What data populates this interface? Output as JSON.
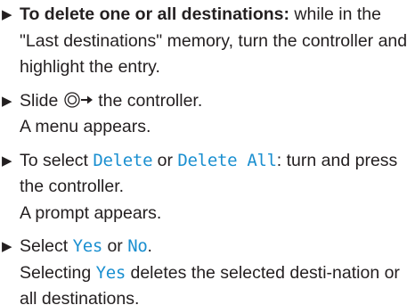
{
  "colors": {
    "text": "#231f20",
    "display_text": "#1a8fd0"
  },
  "steps": [
    {
      "bullet": "▶",
      "bold": "To delete one or all destinations:",
      "text": " while in the \"Last destinations\" memory, turn the controller and highlight the entry."
    },
    {
      "bullet": "▶",
      "pre": "Slide ",
      "icon": "controller-slide-right-icon",
      "post": " the controller.",
      "result": "A menu appears."
    },
    {
      "bullet": "▶",
      "pre": "To select ",
      "opt1": "Delete",
      "mid": " or ",
      "opt2": "Delete All",
      "post": ": turn and press the controller.",
      "result": "A prompt appears."
    },
    {
      "bullet": "▶",
      "pre": "Select ",
      "opt1": "Yes",
      "mid": " or ",
      "opt2": "No",
      "post": ".",
      "result_pre": "Selecting ",
      "result_opt": "Yes",
      "result_post": " deletes the selected desti-nation or all destinations."
    }
  ]
}
